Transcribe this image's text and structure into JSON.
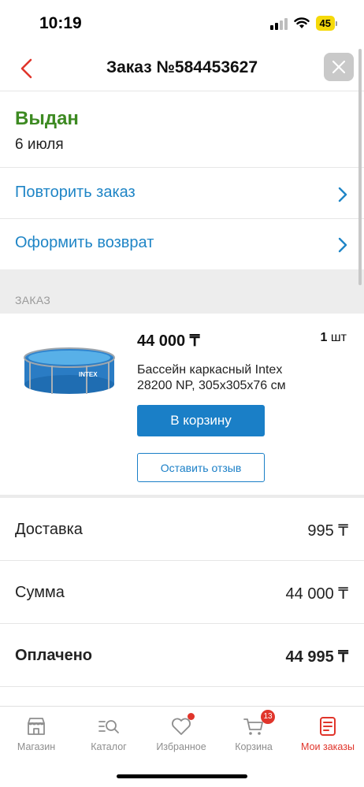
{
  "status_bar": {
    "time": "10:19",
    "battery": "45"
  },
  "header": {
    "title": "Заказ №584453627"
  },
  "order": {
    "status": "Выдан",
    "date": "6 июля",
    "actions": [
      {
        "label": "Повторить заказ"
      },
      {
        "label": "Оформить возврат"
      }
    ],
    "section_label": "ЗАКАЗ"
  },
  "product": {
    "price": "44 000 ₸",
    "qty_number": "1",
    "qty_unit": "шт",
    "name": "Бассейн каркасный Intex 28200 NP, 305x305x76 см",
    "image_brand": "INTEX",
    "cart_button": "В корзину",
    "review_button": "Оставить отзыв"
  },
  "summary": [
    {
      "label": "Доставка",
      "value": "995 ₸"
    },
    {
      "label": "Сумма",
      "value": "44 000 ₸"
    },
    {
      "label": "Оплачено",
      "value": "44 995 ₸"
    }
  ],
  "nav": {
    "items": [
      {
        "label": "Магазин"
      },
      {
        "label": "Каталог"
      },
      {
        "label": "Избранное"
      },
      {
        "label": "Корзина",
        "badge": "13"
      },
      {
        "label": "Мои заказы"
      }
    ]
  },
  "colors": {
    "accent_blue": "#1a7fc7",
    "status_green": "#3d8a22",
    "active_red": "#e0352b"
  }
}
